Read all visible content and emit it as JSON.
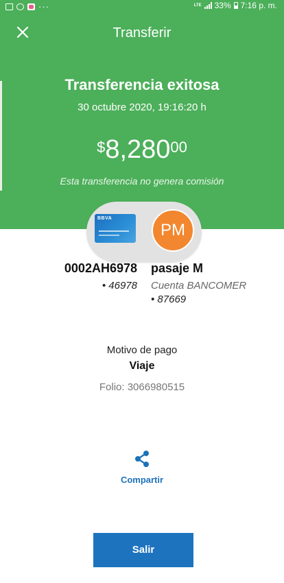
{
  "status_bar": {
    "dots": "···",
    "network": "LTE",
    "battery": "33%",
    "time": "7:16 p. m."
  },
  "header": {
    "title": "Transferir",
    "close_icon": "close-icon"
  },
  "result": {
    "title": "Transferencia exitosa",
    "datetime": "30 octubre 2020, 19:16:20 h",
    "amount_currency": "$",
    "amount_integer": "8,280",
    "amount_cents": "00",
    "commission_note": "Esta transferencia no genera comisión"
  },
  "origin": {
    "card_brand": "BBVA",
    "account_id": "0002AH6978",
    "account_number": "• 46978"
  },
  "destination": {
    "initials": "PM",
    "name": "pasaje M",
    "bank": "Cuenta BANCOMER",
    "account_number": "• 87669"
  },
  "details": {
    "motivo_label": "Motivo de pago",
    "motivo_value": "Viaje",
    "folio": "Folio: 3066980515"
  },
  "actions": {
    "share_label": "Compartir",
    "share_icon": "share-icon",
    "exit_label": "Salir"
  },
  "colors": {
    "header_green": "#4caf5a",
    "primary_blue": "#1d73be",
    "avatar_orange": "#f2872f"
  }
}
